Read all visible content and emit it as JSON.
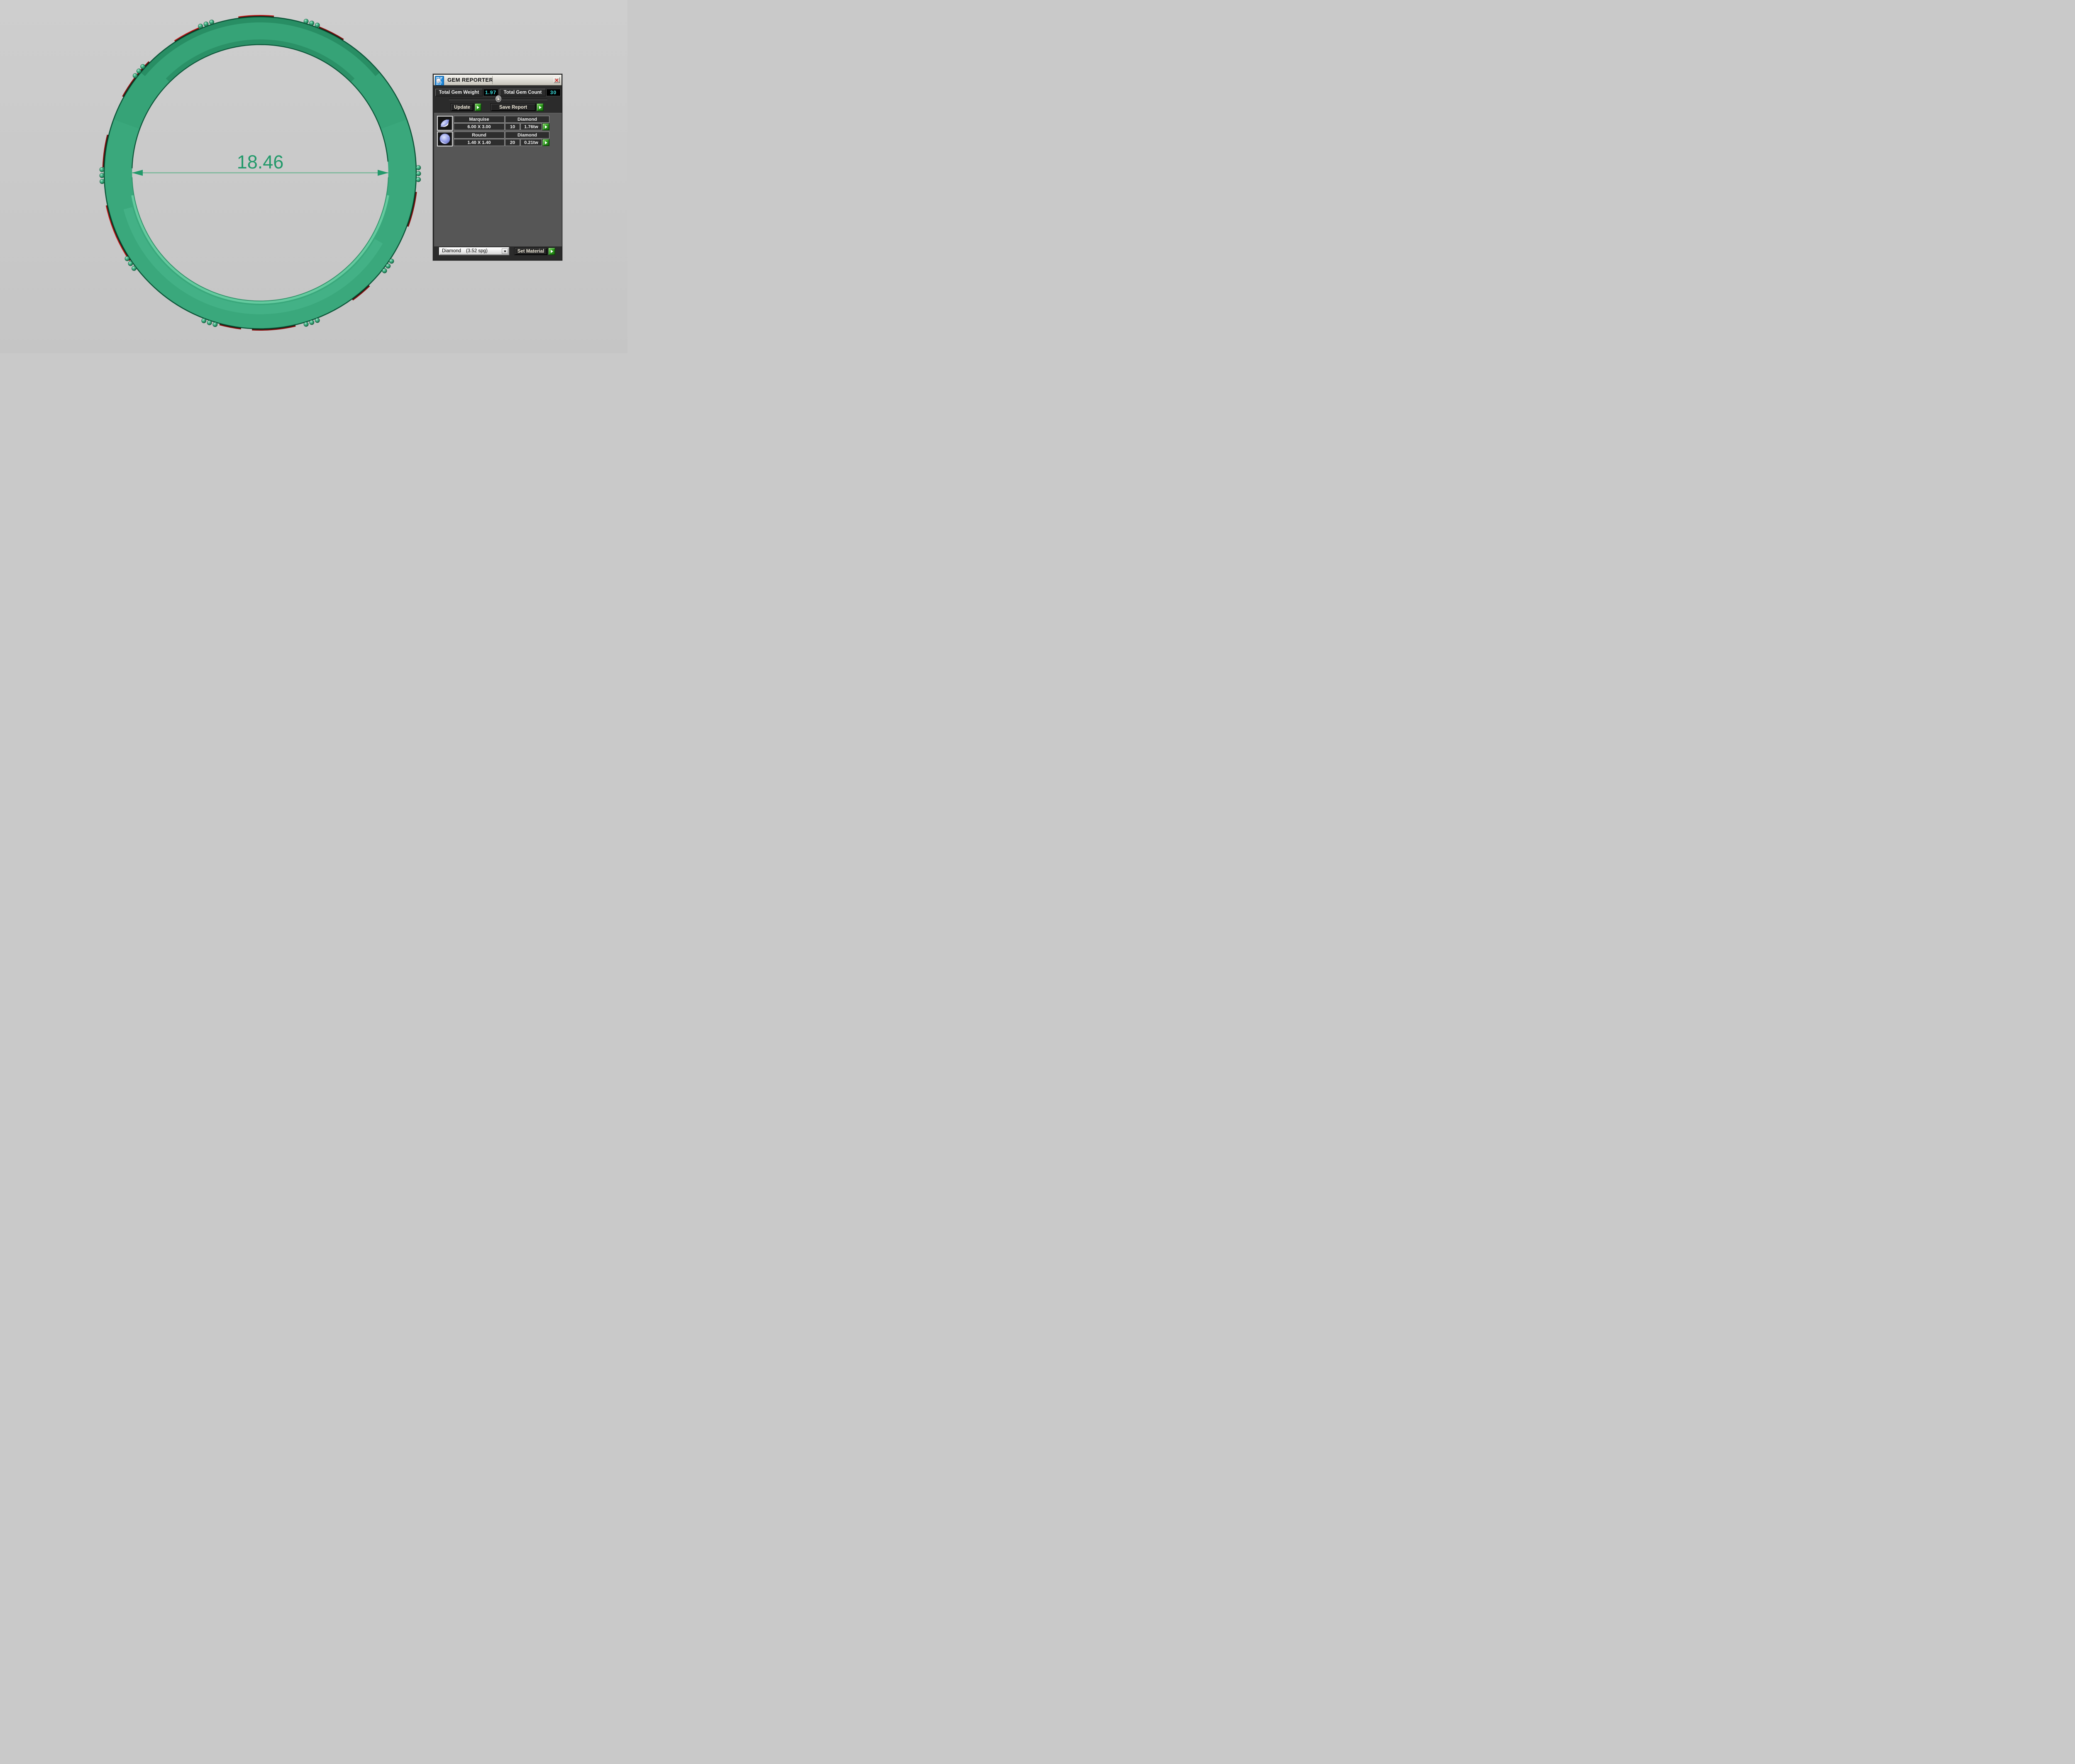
{
  "window": {
    "title": "GEM REPORTER"
  },
  "totals": {
    "weight_label": "Total Gem Weight",
    "weight_value": "1.97",
    "count_label": "Total Gem Count",
    "count_value": "30"
  },
  "actions": {
    "update_label": "Update",
    "save_report_label": "Save Report",
    "set_material_label": "Set Material"
  },
  "material_dropdown": {
    "selected_name": "Diamond",
    "selected_density": "(3.52 spg)"
  },
  "gems": [
    {
      "shape": "Marquise",
      "material": "Diamond",
      "size": "6.00 X 3.00",
      "count": "10",
      "total_weight": "1.76tw"
    },
    {
      "shape": "Round",
      "material": "Diamond",
      "size": "1.40 X 1.40",
      "count": "20",
      "total_weight": "0.21tw"
    }
  ],
  "viewport": {
    "dimension_label": "18.46",
    "colors": {
      "ring_green": "#3aa87c",
      "ring_edge_dark": "#0d573a",
      "back_ring_red_bright": "#c01515",
      "back_ring_red_dark": "#8c0f0f",
      "dimension_green": "#22996a",
      "dimension_line": "#74b796",
      "background_gray": "#cbcbcb",
      "value_cyan": "#3fe8e8",
      "button_green": "#2f9e1f"
    },
    "bead_cluster_angles_deg": [
      71,
      110,
      140,
      181,
      215,
      251.3,
      289,
      323.9,
      359.7
    ],
    "red_arcs": [
      {
        "from": 58,
        "to": 68,
        "tone": "dark"
      },
      {
        "from": 85,
        "to": 98,
        "tone": "bright"
      },
      {
        "from": 113,
        "to": 123,
        "tone": "bright"
      },
      {
        "from": 135,
        "to": 151,
        "tone": "dark"
      },
      {
        "from": 166,
        "to": 178,
        "tone": "dark"
      },
      {
        "from": 192,
        "to": 214,
        "tone": "bright"
      },
      {
        "from": 255,
        "to": 263,
        "tone": "dark"
      },
      {
        "from": 267,
        "to": 283,
        "tone": "dark"
      },
      {
        "from": 306,
        "to": 314,
        "tone": "dark"
      },
      {
        "from": 340,
        "to": 353,
        "tone": "dark"
      }
    ]
  }
}
